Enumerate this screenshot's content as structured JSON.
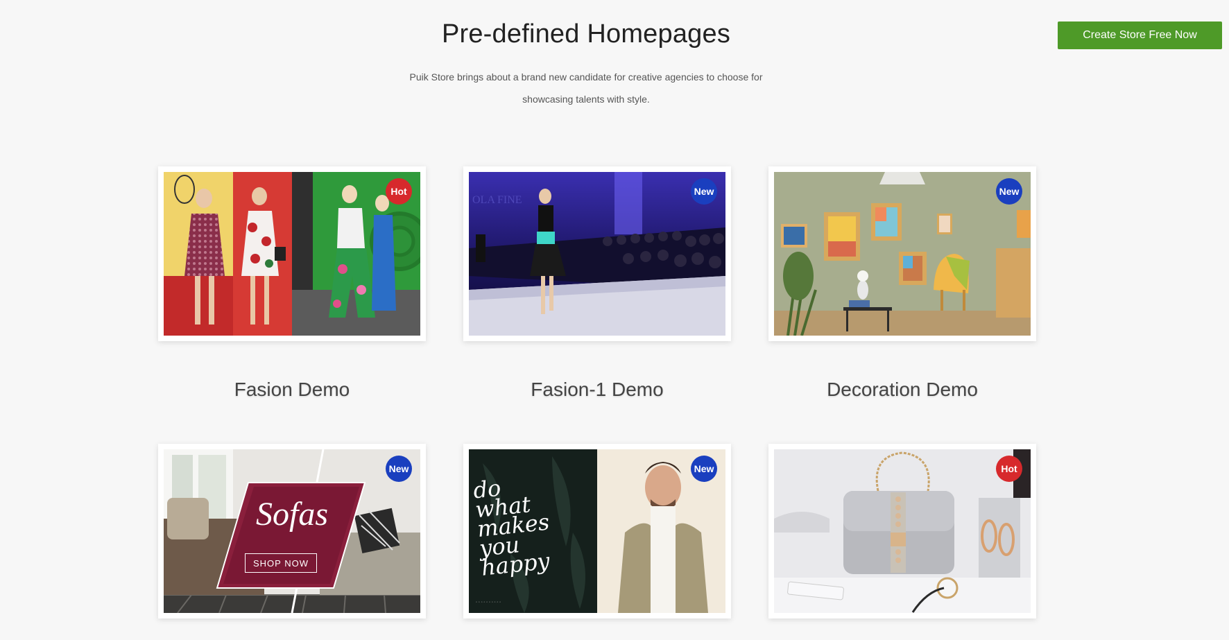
{
  "header": {
    "title": "Pre-defined Homepages",
    "subtitle_line1": "Puik Store brings about a brand new candidate for creative agencies to choose for",
    "subtitle_line2": "showcasing talents with style.",
    "cta_label": "Create Store Free Now"
  },
  "colors": {
    "cta": "#4e9a28",
    "badge_hot": "#d7292c",
    "badge_new": "#1a3fbf",
    "page_bg": "#f7f7f7"
  },
  "demos": [
    {
      "name": "Fasion Demo",
      "badge": "Hot",
      "image": "fashion-models-thumbnail"
    },
    {
      "name": "Fasion-1 Demo",
      "badge": "New",
      "image": "runway-model-thumbnail"
    },
    {
      "name": "Decoration Demo",
      "badge": "New",
      "image": "home-decor-room-thumbnail"
    },
    {
      "name": "",
      "badge": "New",
      "image": "sofas-banner-thumbnail",
      "banner_text": "Sofas",
      "banner_button": "SHOP NOW"
    },
    {
      "name": "",
      "badge": "New",
      "image": "menswear-thumbnail",
      "script_text": "do what makes you happy"
    },
    {
      "name": "",
      "badge": "Hot",
      "image": "handbag-accessories-thumbnail"
    }
  ]
}
